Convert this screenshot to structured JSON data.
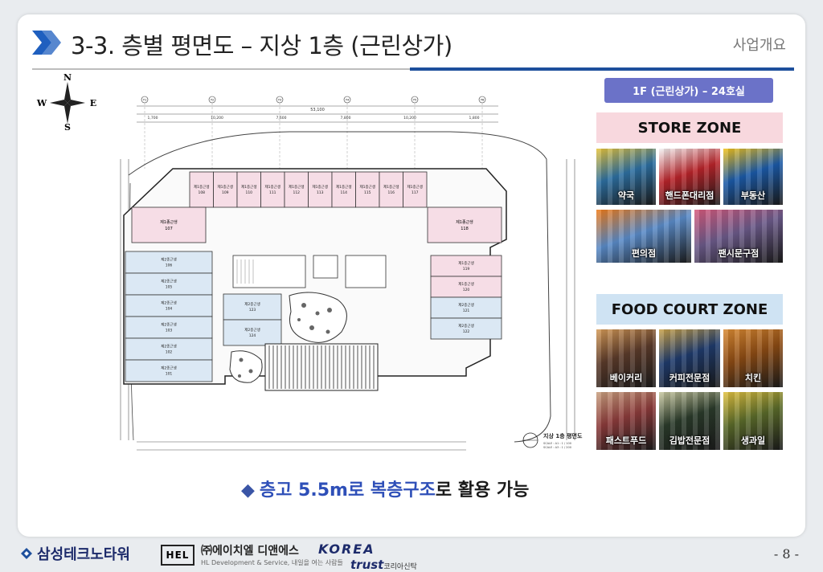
{
  "header": {
    "title": "3-3. 층별 평면도 – 지상 1층 (근린상가)",
    "section": "사업개요"
  },
  "compass": {
    "n": "N",
    "s": "S",
    "e": "E",
    "w": "W"
  },
  "floor_plan": {
    "title": "지상 1층 평면도",
    "scale_line1": "SCALE : A1 : 1 / 100",
    "scale_line2": "SCALE : A3 : 1 / 200",
    "north_units": [
      {
        "no": "108",
        "label": "제1종근생"
      },
      {
        "no": "109",
        "label": "제1종근생"
      },
      {
        "no": "110",
        "label": "제1종근생"
      },
      {
        "no": "111",
        "label": "제1종근생"
      },
      {
        "no": "112",
        "label": "제1종근생"
      },
      {
        "no": "113",
        "label": "제1종근생"
      },
      {
        "no": "114",
        "label": "제1종근생"
      },
      {
        "no": "115",
        "label": "제1종근생"
      },
      {
        "no": "116",
        "label": "제1종근생"
      },
      {
        "no": "117",
        "label": "제1종근생"
      }
    ],
    "unit_107": {
      "no": "107",
      "label": "제1종근생"
    },
    "unit_118": {
      "no": "118",
      "label": "제1종근생"
    },
    "west_units": [
      {
        "no": "106",
        "label": "제2종근생"
      },
      {
        "no": "105",
        "label": "제2종근생"
      },
      {
        "no": "104",
        "label": "제2종근생"
      },
      {
        "no": "103",
        "label": "제2종근생"
      },
      {
        "no": "102",
        "label": "제2종근생"
      },
      {
        "no": "101",
        "label": "제2종근생"
      }
    ],
    "center_units": [
      {
        "no": "123",
        "label": "제2종근생"
      },
      {
        "no": "124",
        "label": "제2종근생"
      }
    ],
    "east_units": [
      {
        "no": "119",
        "label": "제1종근생"
      },
      {
        "no": "120",
        "label": "제1종근생"
      },
      {
        "no": "121",
        "label": "제2종근생"
      },
      {
        "no": "122",
        "label": "제2종근생"
      }
    ],
    "top_dims": [
      "1,700",
      "10,200",
      "7,600",
      "7,800",
      "10,200",
      "1,800"
    ],
    "total_dim": "53,100",
    "axis_labels": [
      "Y1",
      "Y2",
      "Y3",
      "Y4",
      "Y5",
      "Y6"
    ]
  },
  "side_panel": {
    "tag": "1F (근린상가) – 24호실",
    "store_zone": {
      "heading": "STORE ZONE",
      "photos": [
        {
          "label": "약국",
          "color": "#2d6fa1",
          "accent": "#e6c33b"
        },
        {
          "label": "핸드폰대리점",
          "color": "#b8242a",
          "accent": "#f2f2f2"
        },
        {
          "label": "부동산",
          "color": "#1b5aa8",
          "accent": "#f3c21a"
        },
        {
          "label": "편의점",
          "color": "#5a8bc8",
          "accent": "#ef7c1a"
        },
        {
          "label": "팬시문구점",
          "color": "#6b5a89",
          "accent": "#d65a7c"
        }
      ]
    },
    "food_zone": {
      "heading": "FOOD COURT ZONE",
      "photos": [
        {
          "label": "베이커리",
          "color": "#5a3a2a",
          "accent": "#d49a58"
        },
        {
          "label": "커피전문점",
          "color": "#1e3a6b",
          "accent": "#c9a24a"
        },
        {
          "label": "치킨",
          "color": "#8a4a14",
          "accent": "#d88a34"
        },
        {
          "label": "패스트푸드",
          "color": "#8a3a3a",
          "accent": "#c8a080"
        },
        {
          "label": "김밥전문점",
          "color": "#2a3a2a",
          "accent": "#c8c8a0"
        },
        {
          "label": "생과일",
          "color": "#5a6a2a",
          "accent": "#e0c040"
        }
      ]
    }
  },
  "note": {
    "prefix": "◆",
    "highlight": "층고 5.5m로 복층구조",
    "rest": "로 활용 가능"
  },
  "footer": {
    "company1": "삼성테크노타워",
    "company2_box": "HEL",
    "company2": "㈜에이치엘 디앤에스",
    "company2_sub": "HL Development & Service, 내일을 여는 사람들",
    "company3_a": "KOREA",
    "company3_b": "trust",
    "company3_ko": "코리아신탁",
    "page": "- 8 -"
  },
  "colors": {
    "accent_blue": "#1f5fbf",
    "rule_blue": "#1d4f9c",
    "rule_gray": "#bdbdbd",
    "tag_purple": "#6b72c8",
    "pink_unit": "#f6dde6",
    "blue_unit": "#dbe8f4"
  }
}
